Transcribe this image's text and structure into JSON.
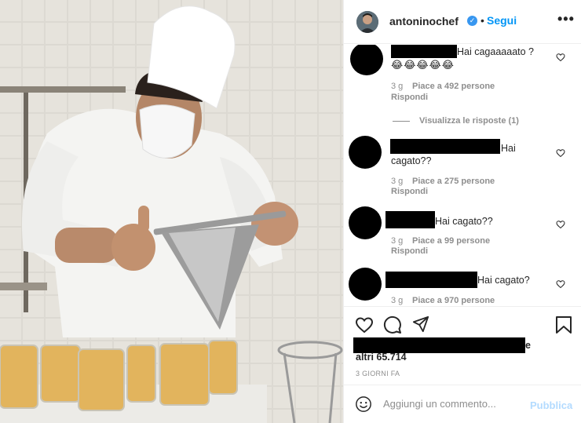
{
  "post": {
    "username": "antoninochef",
    "follow_label": "Segui",
    "separator": "•",
    "more_label": "•••"
  },
  "comments": [
    {
      "text": "Hai cagaaaaato ?",
      "emoji": "😂😂😂😂😂",
      "time": "3 g",
      "likes": "Piace a 492 persone",
      "reply_label": "Rispondi",
      "view_replies": "Visualizza le risposte (1)"
    },
    {
      "text_tail": "Hai",
      "text_line2": "cagato??",
      "time": "3 g",
      "likes": "Piace a 275 persone",
      "reply_label": "Rispondi"
    },
    {
      "text": "Hai cagato??",
      "time": "3 g",
      "likes": "Piace a 99 persone",
      "reply_label": "Rispondi"
    },
    {
      "text": "Hai cagato?",
      "time": "3 g",
      "likes": "Piace a 970 persone"
    }
  ],
  "likes_summary": {
    "suffix": "e",
    "line2": "altri 65.714"
  },
  "time_ago": "3 GIORNI FA",
  "comment_box": {
    "placeholder": "Aggiungi un commento...",
    "publish_label": "Pubblica"
  },
  "colors": {
    "accent": "#0095f6",
    "publish_disabled": "#b3dbff",
    "verified": "#3897f0"
  }
}
